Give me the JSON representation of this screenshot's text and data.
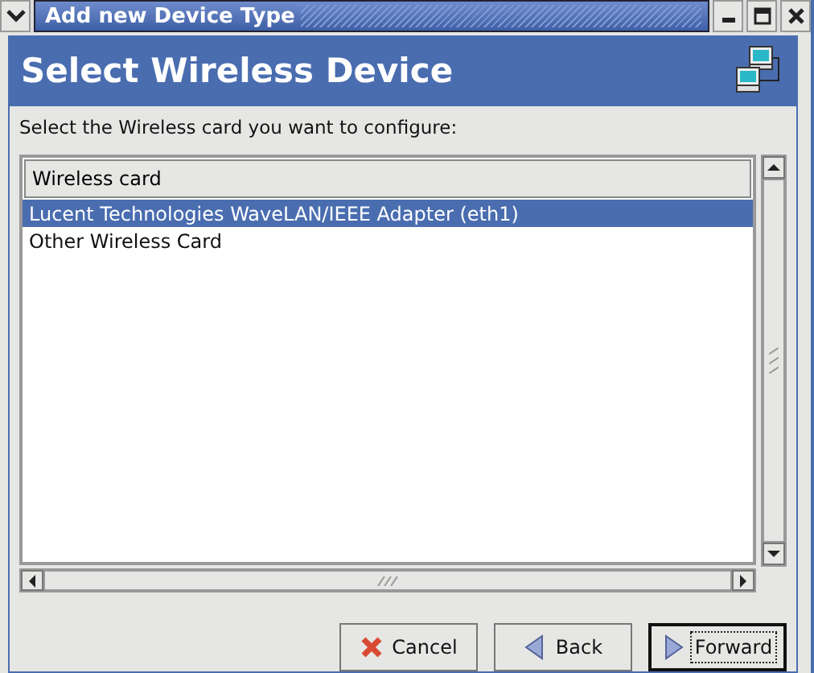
{
  "window": {
    "title": "Add new Device Type"
  },
  "header": {
    "title": "Select Wireless Device"
  },
  "instruction": "Select the Wireless card you want to configure:",
  "list": {
    "columns": [
      "Wireless card"
    ],
    "rows": [
      {
        "label": "Lucent Technologies WaveLAN/IEEE Adapter (eth1)",
        "selected": true
      },
      {
        "label": "Other Wireless Card",
        "selected": false
      }
    ]
  },
  "buttons": [
    {
      "kind": "cancel",
      "label": "Cancel",
      "focused": false
    },
    {
      "kind": "back",
      "label": "Back",
      "focused": false
    },
    {
      "kind": "forward",
      "label": "Forward",
      "focused": true
    }
  ]
}
